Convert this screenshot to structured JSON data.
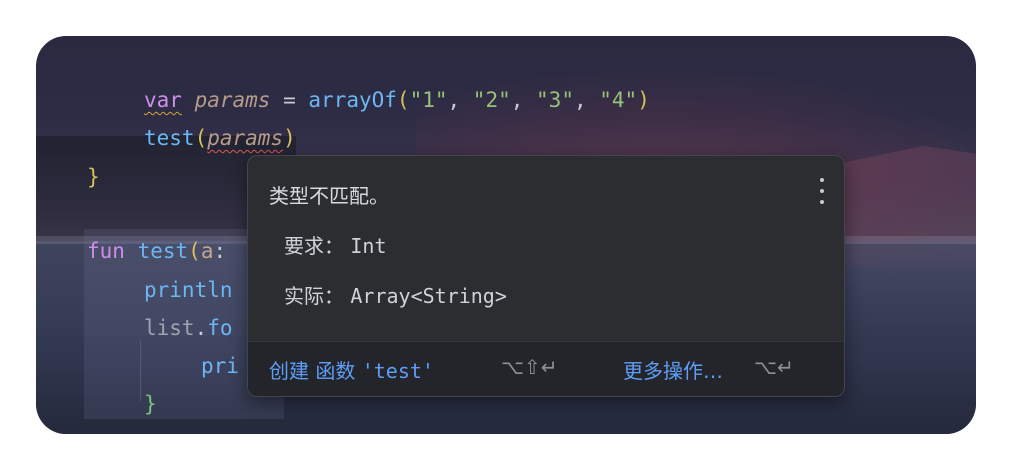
{
  "editor": {
    "lines": {
      "l1": {
        "kw": "var",
        "name": "params",
        "eq": " = ",
        "fn": "arrayOf",
        "open": "(",
        "s1": "\"1\"",
        "s2": "\"2\"",
        "s3": "\"3\"",
        "s4": "\"4\"",
        "comma": ", ",
        "close": ")"
      },
      "l2": {
        "fn": "test",
        "open": "(",
        "arg": "params",
        "close": ")"
      },
      "l3": {
        "brace": "}"
      },
      "l4": {
        "kw": "fun",
        "fn": "test",
        "open": "(",
        "arg": "a",
        "colon": ":"
      },
      "l5": {
        "text": "println"
      },
      "l6": {
        "gray": "list",
        "dot": ".",
        "rest": "fo"
      },
      "l7": {
        "text": "pri"
      },
      "l8": {
        "brace": "}"
      }
    }
  },
  "popup": {
    "title": "类型不匹配。",
    "required_label": "要求：",
    "required_value": "Int",
    "actual_label": "实际：",
    "actual_value": "Array<String>",
    "action_create_prefix": "创建 函数 ",
    "action_create_name": "'test'",
    "action_create_shortcut": "⌥⇧↵",
    "action_more": "更多操作…",
    "action_more_shortcut": "⌥↵"
  }
}
